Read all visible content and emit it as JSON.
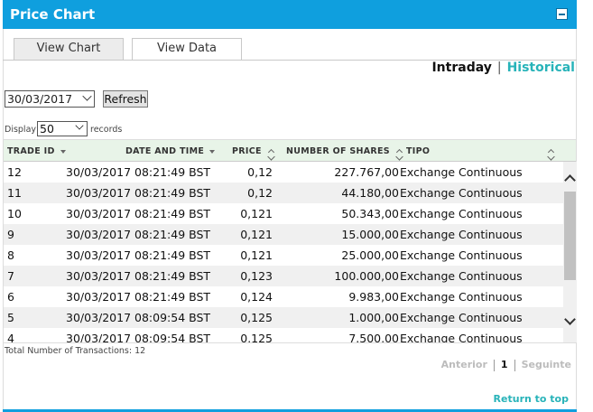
{
  "header": {
    "title": "Price Chart",
    "minimize_icon": "minimize-icon"
  },
  "tabs": [
    {
      "label": "View Chart",
      "active": false
    },
    {
      "label": "View Data",
      "active": true
    }
  ],
  "range": {
    "intraday": "Intraday",
    "separator": "|",
    "historical": "Historical",
    "active_color": "#28b3b9"
  },
  "filters": {
    "date_value": "30/03/2017",
    "refresh_label": "Refresh",
    "display_label": "Display",
    "display_value": "50",
    "records_label": "records"
  },
  "table": {
    "columns": [
      "TRADE ID",
      "DATE AND TIME",
      "PRICE",
      "NUMBER OF SHARES",
      "TIPO"
    ],
    "rows": [
      {
        "id": "12",
        "datetime": "30/03/2017 08:21:49 BST",
        "price": "0,12",
        "shares": "227.767,00",
        "tipo": "Exchange Continuous"
      },
      {
        "id": "11",
        "datetime": "30/03/2017 08:21:49 BST",
        "price": "0,12",
        "shares": "44.180,00",
        "tipo": "Exchange Continuous"
      },
      {
        "id": "10",
        "datetime": "30/03/2017 08:21:49 BST",
        "price": "0,121",
        "shares": "50.343,00",
        "tipo": "Exchange Continuous"
      },
      {
        "id": "9",
        "datetime": "30/03/2017 08:21:49 BST",
        "price": "0,121",
        "shares": "15.000,00",
        "tipo": "Exchange Continuous"
      },
      {
        "id": "8",
        "datetime": "30/03/2017 08:21:49 BST",
        "price": "0,121",
        "shares": "25.000,00",
        "tipo": "Exchange Continuous"
      },
      {
        "id": "7",
        "datetime": "30/03/2017 08:21:49 BST",
        "price": "0,123",
        "shares": "100.000,00",
        "tipo": "Exchange Continuous"
      },
      {
        "id": "6",
        "datetime": "30/03/2017 08:21:49 BST",
        "price": "0,124",
        "shares": "9.983,00",
        "tipo": "Exchange Continuous"
      },
      {
        "id": "5",
        "datetime": "30/03/2017 08:09:54 BST",
        "price": "0,125",
        "shares": "1.000,00",
        "tipo": "Exchange Continuous"
      },
      {
        "id": "4",
        "datetime": "30/03/2017 08:09:54 BST",
        "price": "0,125",
        "shares": "7.500,00",
        "tipo": "Exchange Continuous"
      }
    ]
  },
  "total_label": "Total Number of Transactions: 12",
  "pagination": {
    "prev": "Anterior",
    "current": "1",
    "next": "Seguinte"
  },
  "return_top": "Return to top",
  "colors": {
    "header_bg": "#0f9fde",
    "accent": "#28b3b9",
    "table_header_bg": "#e8f4e8",
    "alt_row_bg": "#f0f0f0"
  }
}
